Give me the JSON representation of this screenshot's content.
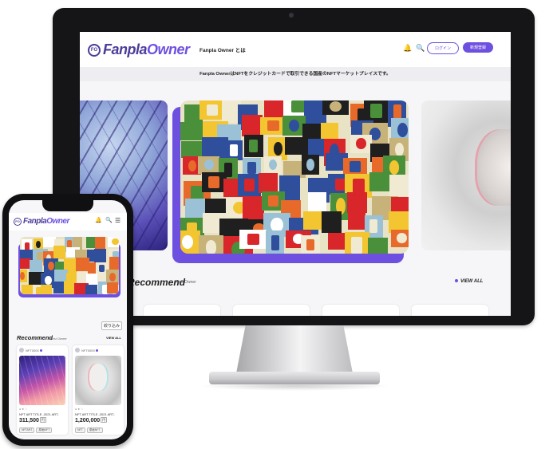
{
  "brand": {
    "name_a": "Fanpla",
    "name_b": "Owner",
    "mark": "FO",
    "accent": "#6e50e0",
    "primary": "#4a3c98"
  },
  "desktop": {
    "header": {
      "about_label": "Fanpla Owner とは",
      "bell_icon": "bell-icon",
      "search_icon": "search-icon",
      "login_label": "ログイン",
      "register_label": "新規登録"
    },
    "banner_text": "Fanpla OwnerはNFTをクレジットカードで取引できる国産のNFTマーケットプレイスです。",
    "recommend": {
      "title": "Recommend",
      "subtitle": "First Owner",
      "view_all": "VIEW ALL"
    }
  },
  "phone": {
    "bell_icon": "bell-icon",
    "search_icon": "search-icon",
    "menu_icon": "hamburger-menu-icon",
    "filter_label": "絞り込み",
    "recommend": {
      "title": "Recommend",
      "subtitle": "First Owner",
      "view_all": "VIEW ALL"
    },
    "cards": [
      {
        "owner": "NFT0000",
        "title": "NFT ART TITLE -2021 ART-",
        "price": "311,500",
        "unit": "円",
        "tags": [
          "NFTART",
          "原画NFT"
        ]
      },
      {
        "owner": "NFT0000",
        "title": "NFT ART TITLE -2021 ART-",
        "price": "1,200,000",
        "unit": "円",
        "tags": [
          "NFT",
          "原画NFT"
        ]
      }
    ]
  }
}
